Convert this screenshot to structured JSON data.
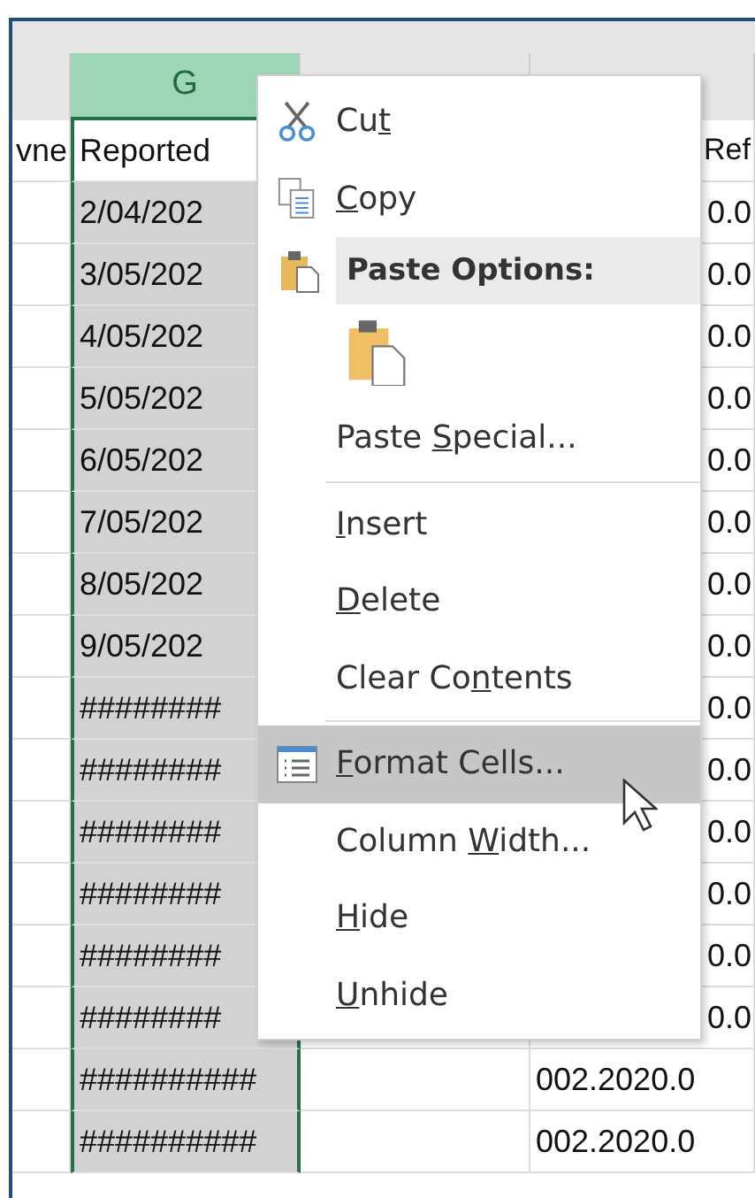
{
  "columns": [
    {
      "letter": "G",
      "selected": true
    }
  ],
  "header_row": {
    "col_f": "vne",
    "col_g": "Reported",
    "col_i": "Ref"
  },
  "rows": [
    {
      "g": "2/04/202",
      "i": "0.0",
      "covered": true
    },
    {
      "g": "3/05/202",
      "i": "0.0",
      "covered": true
    },
    {
      "g": "4/05/202",
      "i": "0.0",
      "covered": true
    },
    {
      "g": "5/05/202",
      "i": "0.0",
      "covered": true
    },
    {
      "g": "6/05/202",
      "i": "0.0",
      "covered": true
    },
    {
      "g": "7/05/202",
      "i": "0.0",
      "covered": true
    },
    {
      "g": "8/05/202",
      "i": "0.0",
      "covered": true
    },
    {
      "g": "9/05/202",
      "i": "0.0",
      "covered": true
    },
    {
      "g": "########",
      "i": "0.0",
      "covered": true
    },
    {
      "g": "########",
      "i": "0.0",
      "covered": true
    },
    {
      "g": "########",
      "i": "0.0",
      "covered": true
    },
    {
      "g": "########",
      "i": "0.0",
      "covered": true
    },
    {
      "g": "########",
      "i": "0.0",
      "covered": true
    },
    {
      "g": "########",
      "i": "0.0",
      "covered": true
    },
    {
      "g": "##########",
      "i": "002.2020.0",
      "covered": false
    },
    {
      "g": "##########",
      "i": "002.2020.0",
      "covered": false
    }
  ],
  "context_menu": {
    "items": [
      {
        "kind": "item",
        "label_parts": {
          "before": "Cu",
          "accel": "t"
        },
        "selected": false
      },
      {
        "kind": "item",
        "label_parts": {
          "accel": "C",
          "after": "opy"
        },
        "selected": false
      },
      {
        "kind": "header",
        "label": "Paste Options:"
      },
      {
        "kind": "paste-icons"
      },
      {
        "kind": "item",
        "label_parts": {
          "before": "Paste ",
          "accel": "S",
          "after": "pecial..."
        },
        "selected": false
      },
      {
        "kind": "separator"
      },
      {
        "kind": "item",
        "label_parts": {
          "accel": "I",
          "after": "nsert"
        },
        "selected": false
      },
      {
        "kind": "item",
        "label_parts": {
          "accel": "D",
          "after": "elete"
        },
        "selected": false
      },
      {
        "kind": "item",
        "label_parts": {
          "before": "Clear Co",
          "accel": "n",
          "after": "tents"
        },
        "selected": false
      },
      {
        "kind": "separator"
      },
      {
        "kind": "item",
        "label_parts": {
          "accel": "F",
          "after": "ormat Cells..."
        },
        "selected": true
      },
      {
        "kind": "item",
        "label_parts": {
          "before": "Column ",
          "accel": "W",
          "after": "idth..."
        },
        "selected": false
      },
      {
        "kind": "item",
        "label_parts": {
          "accel": "H",
          "after": "ide"
        },
        "selected": false
      },
      {
        "kind": "item",
        "label_parts": {
          "accel": "U",
          "after": "nhide"
        },
        "selected": false
      }
    ]
  }
}
